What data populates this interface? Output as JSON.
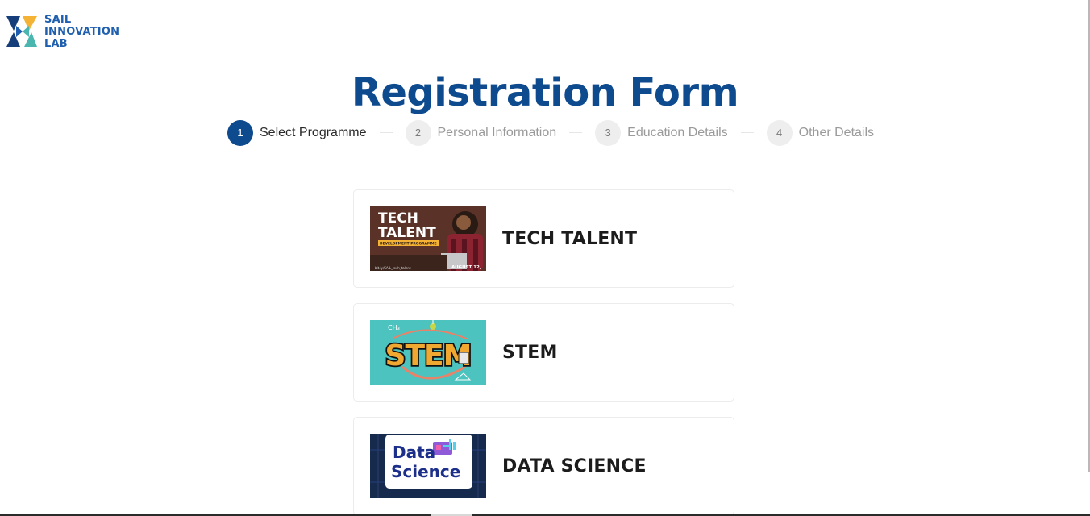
{
  "logo": {
    "line1": "SAIL",
    "line2": "INNOVATION",
    "line3": "LAB",
    "icon": "sail-innovation-lab-logo-icon",
    "colors": {
      "blue": "#1f5fae",
      "yellow": "#f5b335",
      "teal": "#49b6b0",
      "navy": "#163e7a"
    }
  },
  "title": "Registration Form",
  "steps": [
    {
      "number": "1",
      "label": "Select Programme",
      "active": true
    },
    {
      "number": "2",
      "label": "Personal Information",
      "active": false
    },
    {
      "number": "3",
      "label": "Education Details",
      "active": false
    },
    {
      "number": "4",
      "label": "Other Details",
      "active": false
    }
  ],
  "programmes": [
    {
      "title": "TECH TALENT",
      "image": {
        "line1": "TECH",
        "line2": "TALENT",
        "banner": "DEVELOPMENT PROGRAMME",
        "date": "AUGUST 12,",
        "url": "bit.ly/SAIL_tech_talent"
      }
    },
    {
      "title": "STEM",
      "image": {
        "word": "STEM",
        "note": "CH₃"
      }
    },
    {
      "title": "DATA SCIENCE",
      "image": {
        "line1": "Data",
        "line2": "Science"
      }
    }
  ],
  "colors": {
    "primary": "#0e4a8e",
    "step_inactive_bg": "#eeeeee",
    "card_border": "#ececec"
  }
}
